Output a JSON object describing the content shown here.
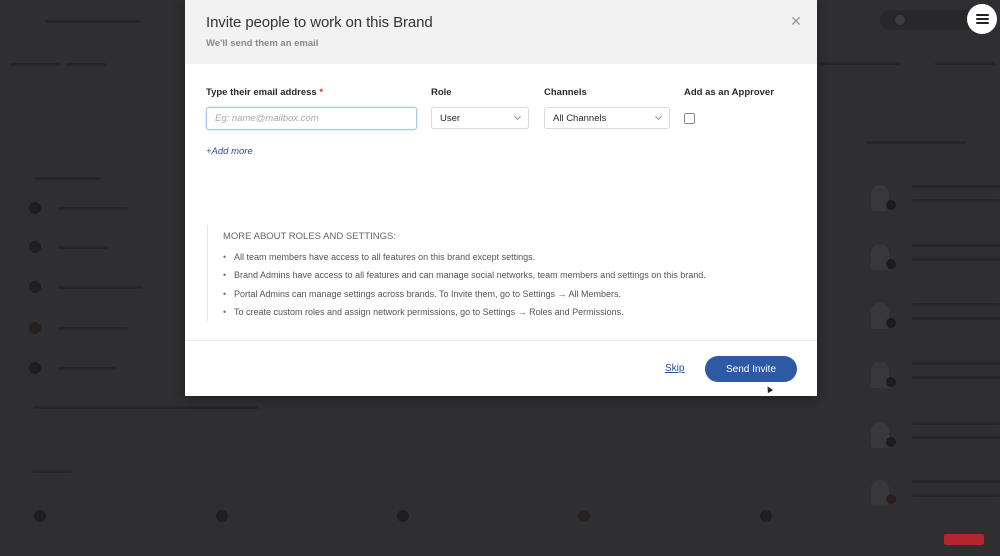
{
  "modal": {
    "title": "Invite people to work on this Brand",
    "subtitle": "We'll send them an email",
    "close_icon": "close-icon",
    "fields": {
      "email": {
        "label": "Type their email address",
        "required_marker": "*",
        "value": "",
        "placeholder": "Eg: name@mailbox.com"
      },
      "role": {
        "label": "Role",
        "selected": "User"
      },
      "channels": {
        "label": "Channels",
        "selected": "All Channels"
      },
      "approver": {
        "label": "Add as an Approver",
        "checked": false
      }
    },
    "add_more_label": "+Add more",
    "info": {
      "title": "MORE ABOUT ROLES AND SETTINGS:",
      "items": [
        "All team members have access to all features on this brand except settings.",
        "Brand Admins have access to all features and can manage social networks, team members and settings on this brand.",
        "Portal Admins can manage settings across brands. To Invite them, go to Settings → All Members.",
        "To create custom roles and assign network permissions, go to Settings → Roles and Permissions."
      ]
    },
    "footer": {
      "skip_label": "Skip",
      "send_label": "Send Invite"
    }
  },
  "overlay": {
    "menu_icon": "hamburger-menu-icon"
  },
  "colors": {
    "primary_button": "#2e5aa3",
    "link": "#2b4f96",
    "required": "#d0342c",
    "backdrop": "#2f2f31"
  }
}
